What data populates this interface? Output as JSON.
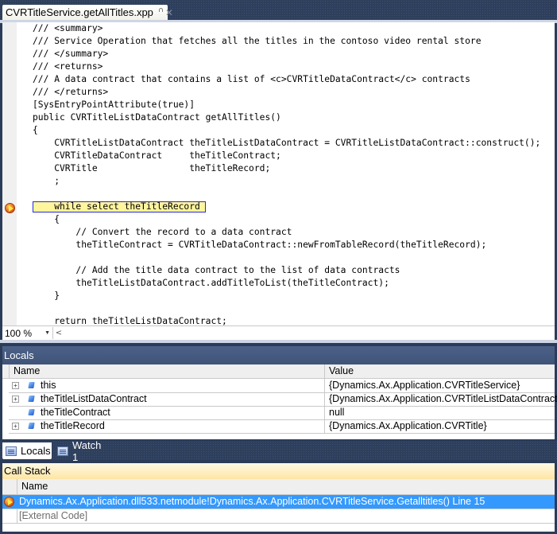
{
  "document_tab": {
    "title": "CVRTitleService.getAllTitles.xpp",
    "lock_icon": "lock-icon",
    "close_icon": "close-icon"
  },
  "editor": {
    "code_lines": [
      "/// <summary>",
      "/// Service Operation that fetches all the titles in the contoso video rental store",
      "/// </summary>",
      "/// <returns>",
      "/// A data contract that contains a list of <c>CVRTitleDataContract</c> contracts",
      "/// </returns>",
      "[SysEntryPointAttribute(true)]",
      "public CVRTitleListDataContract getAllTitles()",
      "{",
      "    CVRTitleListDataContract theTitleListDataContract = CVRTitleListDataContract::construct();",
      "    CVRTitleDataContract     theTitleContract;",
      "    CVRTitle                 theTitleRecord;",
      "    ;",
      "",
      "    while select theTitleRecord",
      "    {",
      "        // Convert the record to a data contract",
      "        theTitleContract = CVRTitleDataContract::newFromTableRecord(theTitleRecord);",
      "",
      "        // Add the title data contract to the list of data contracts",
      "        theTitleListDataContract.addTitleToList(theTitleContract);",
      "    }",
      "",
      "    return theTitleListDataContract;"
    ],
    "current_line_index": 14,
    "current_statement_icon": "current-statement-arrow-icon",
    "zoom_level": "100 %"
  },
  "locals": {
    "title": "Locals",
    "columns": [
      "Name",
      "Value"
    ],
    "rows": [
      {
        "name": "this",
        "value": "{Dynamics.Ax.Application.CVRTitleService}",
        "expandable": true
      },
      {
        "name": "theTitleListDataContract",
        "value": "{Dynamics.Ax.Application.CVRTitleListDataContract}",
        "expandable": true
      },
      {
        "name": "theTitleContract",
        "value": "null",
        "expandable": false
      },
      {
        "name": "theTitleRecord",
        "value": "{Dynamics.Ax.Application.CVRTitle}",
        "expandable": true
      }
    ]
  },
  "bottom_tabs": [
    {
      "label": "Locals",
      "active": true
    },
    {
      "label": "Watch 1",
      "active": false
    }
  ],
  "call_stack": {
    "title": "Call Stack",
    "columns": [
      "Name"
    ],
    "rows": [
      {
        "text": "Dynamics.Ax.Application.dll533.netmodule!Dynamics.Ax.Application.CVRTitleService.Getalltitles() Line 15",
        "selected": true,
        "current": true
      },
      {
        "text": "[External Code]",
        "selected": false,
        "current": false
      }
    ]
  }
}
